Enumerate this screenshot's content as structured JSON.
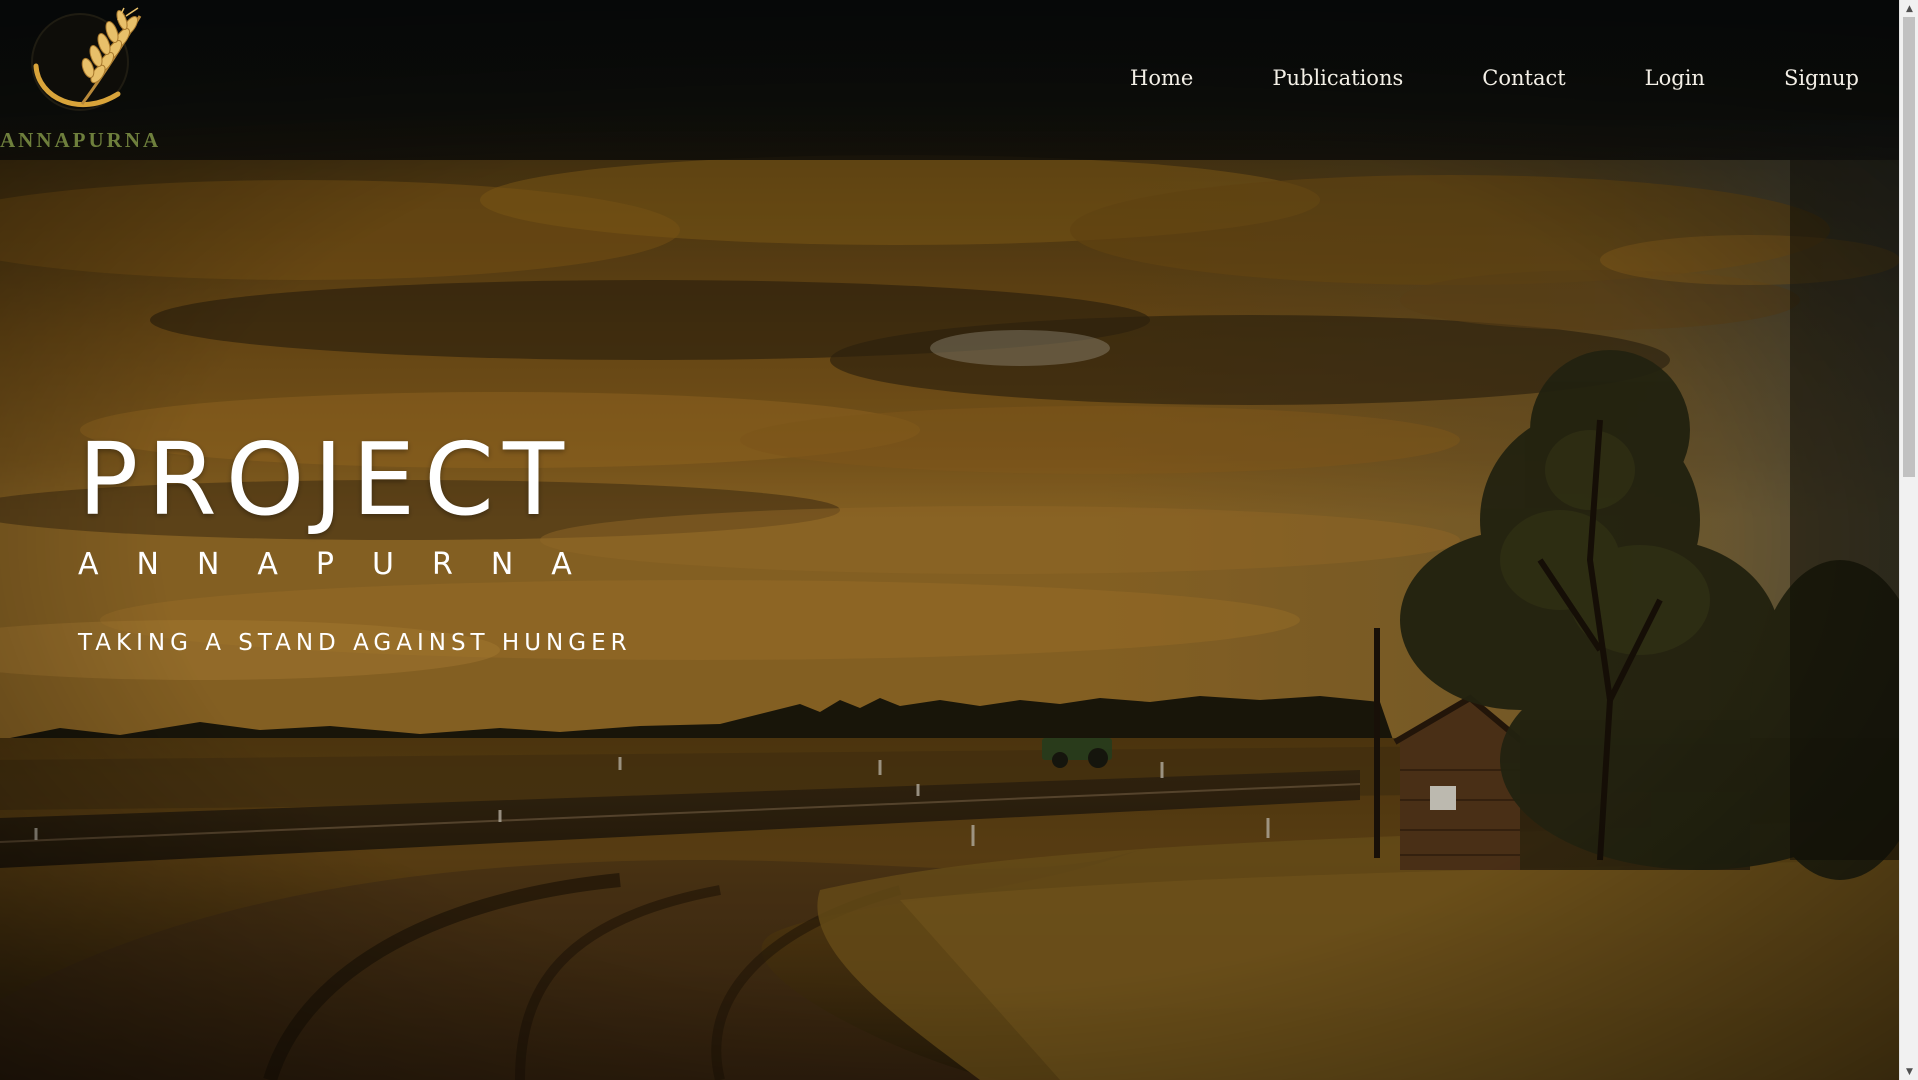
{
  "header": {
    "logo_text": "ANNAPURNA",
    "logo_icon": "wheat-emblem-icon",
    "nav": [
      {
        "label": "Home"
      },
      {
        "label": "Publications"
      },
      {
        "label": "Contact"
      },
      {
        "label": "Login"
      },
      {
        "label": "Signup"
      }
    ]
  },
  "hero": {
    "title": "PROJECT",
    "subtitle": "ANNAPURNA",
    "tagline": "TAKING A STAND AGAINST HUNGER"
  },
  "colors": {
    "logo_text": "#6e7f3c",
    "logo_gold": "#d9a43a",
    "nav_text": "#f3efe6",
    "hero_text": "#ffffff",
    "sky": "#5a3d12",
    "field": "#6a4a14"
  }
}
